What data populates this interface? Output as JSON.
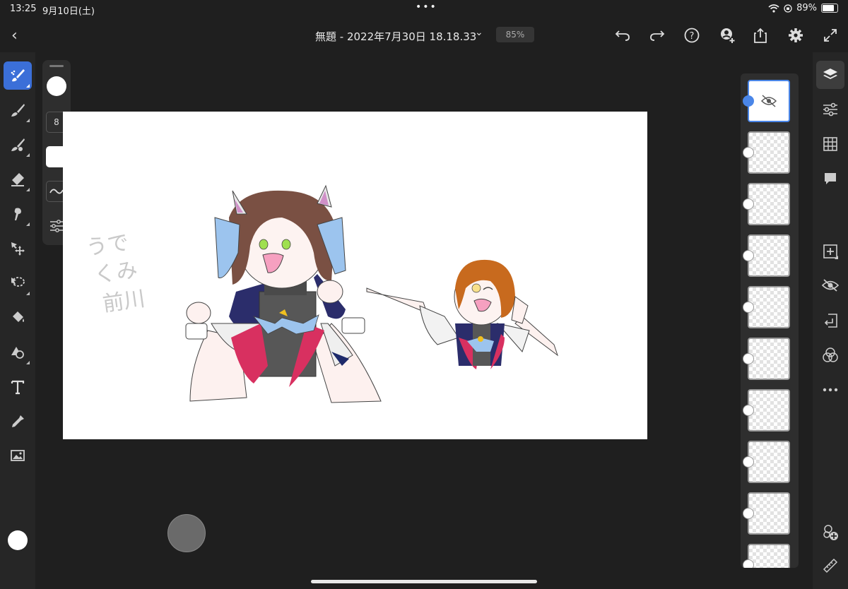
{
  "status": {
    "time": "13:25",
    "date": "9月10日(土)",
    "battery": "89%",
    "battery_level": 0.89
  },
  "document": {
    "title": "無題 - 2022年7月30日 18.18.33",
    "zoom": "85%"
  },
  "toolbar_left": {
    "tools": [
      "brush-selection-icon",
      "paint-brush-icon",
      "pixel-brush-icon",
      "eraser-icon",
      "smudge-icon",
      "move-icon",
      "lasso-icon",
      "fill-icon",
      "shape-icon",
      "text-icon",
      "eyedropper-icon",
      "image-icon"
    ],
    "active": "brush-selection-icon"
  },
  "brush_panel": {
    "size": "8"
  },
  "layers": {
    "count": 10,
    "selected_index": 0
  },
  "toolbar_right": {
    "tools": [
      "layers-icon",
      "adjustments-icon",
      "grid-icon",
      "comment-icon",
      "add-layer-icon",
      "hide-layer-icon",
      "import-icon",
      "blend-icon",
      "more-icon",
      "add-asset-icon",
      "ruler-icon"
    ]
  },
  "canvas_text": {
    "handwriting": "うでくみ前川"
  }
}
